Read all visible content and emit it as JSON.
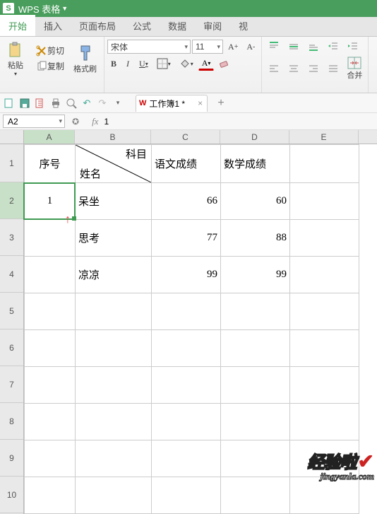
{
  "titlebar": {
    "app": "WPS 表格"
  },
  "menu": {
    "start": "开始",
    "insert": "插入",
    "layout": "页面布局",
    "formula": "公式",
    "data": "数据",
    "review": "审阅",
    "view": "视"
  },
  "ribbon": {
    "cut": "剪切",
    "copy": "复制",
    "paste": "粘贴",
    "format_painter": "格式刷",
    "font": "宋体",
    "size": "11",
    "b": "B",
    "i": "I",
    "u": "U",
    "merge": "合并"
  },
  "doc": {
    "name": "工作簿1 *"
  },
  "cellref": {
    "name": "A2",
    "value": "1"
  },
  "cols": [
    "A",
    "B",
    "C",
    "D",
    "E"
  ],
  "rows": [
    "1",
    "2",
    "3",
    "4",
    "5",
    "6",
    "7",
    "8",
    "9",
    "10"
  ],
  "table": {
    "r1": {
      "a": "序号",
      "b_top": "科目",
      "b_bottom": "姓名",
      "c": "语文成绩",
      "d": "数学成绩"
    },
    "r2": {
      "a": "1",
      "b": "呆坐",
      "c": "66",
      "d": "60"
    },
    "r3": {
      "b": "思考",
      "c": "77",
      "d": "88"
    },
    "r4": {
      "b": "凉凉",
      "c": "99",
      "d": "99"
    }
  },
  "watermark": {
    "big": "经验啦",
    "small": "jingyanla.com"
  }
}
